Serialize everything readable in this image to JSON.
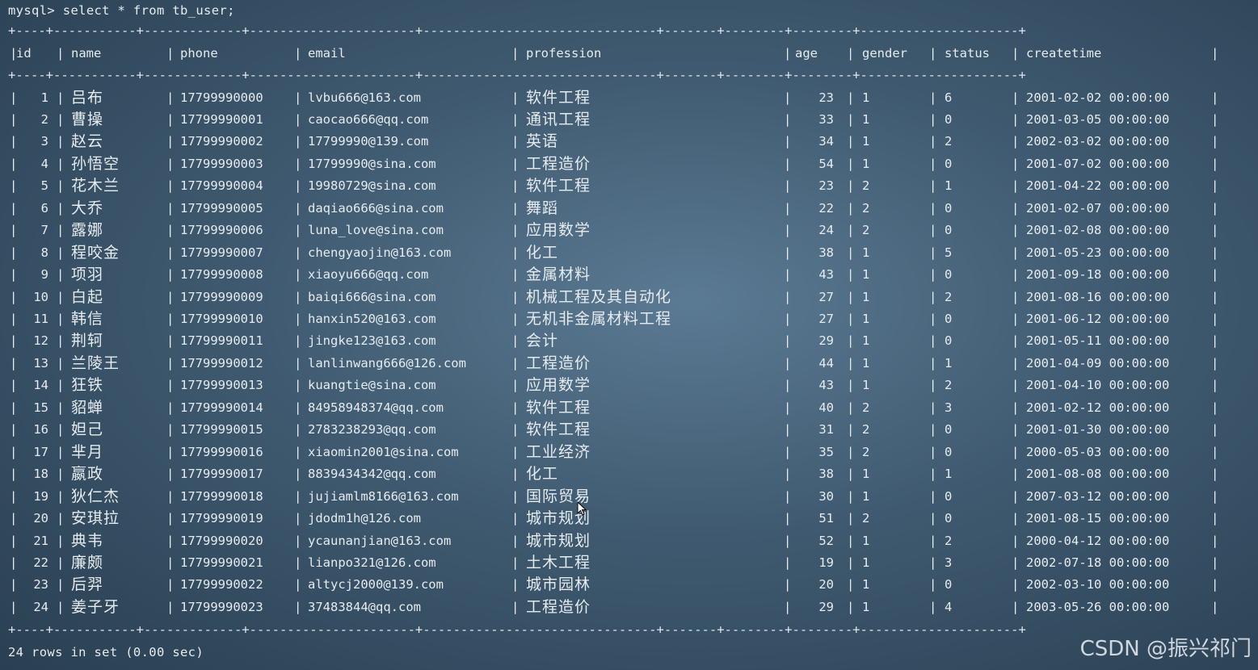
{
  "prompt": "mysql> select * from tb_user;",
  "separator": "+----+-----------+-------------+----------------------+-------------------------------+-------+--------+--------+---------------------+",
  "columns": [
    "id",
    "name",
    "phone",
    "email",
    "profession",
    "age",
    "gender",
    "status",
    "createtime"
  ],
  "rows": [
    [
      "1",
      "吕布",
      "17799990000",
      "lvbu666@163.com",
      "软件工程",
      "23",
      "1",
      "6",
      "2001-02-02 00:00:00"
    ],
    [
      "2",
      "曹操",
      "17799990001",
      "caocao666@qq.com",
      "通讯工程",
      "33",
      "1",
      "0",
      "2001-03-05 00:00:00"
    ],
    [
      "3",
      "赵云",
      "17799990002",
      "17799990@139.com",
      "英语",
      "34",
      "1",
      "2",
      "2002-03-02 00:00:00"
    ],
    [
      "4",
      "孙悟空",
      "17799990003",
      "17799990@sina.com",
      "工程造价",
      "54",
      "1",
      "0",
      "2001-07-02 00:00:00"
    ],
    [
      "5",
      "花木兰",
      "17799990004",
      "19980729@sina.com",
      "软件工程",
      "23",
      "2",
      "1",
      "2001-04-22 00:00:00"
    ],
    [
      "6",
      "大乔",
      "17799990005",
      "daqiao666@sina.com",
      "舞蹈",
      "22",
      "2",
      "0",
      "2001-02-07 00:00:00"
    ],
    [
      "7",
      "露娜",
      "17799990006",
      "luna_love@sina.com",
      "应用数学",
      "24",
      "2",
      "0",
      "2001-02-08 00:00:00"
    ],
    [
      "8",
      "程咬金",
      "17799990007",
      "chengyaojin@163.com",
      "化工",
      "38",
      "1",
      "5",
      "2001-05-23 00:00:00"
    ],
    [
      "9",
      "项羽",
      "17799990008",
      "xiaoyu666@qq.com",
      "金属材料",
      "43",
      "1",
      "0",
      "2001-09-18 00:00:00"
    ],
    [
      "10",
      "白起",
      "17799990009",
      "baiqi666@sina.com",
      "机械工程及其自动化",
      "27",
      "1",
      "2",
      "2001-08-16 00:00:00"
    ],
    [
      "11",
      "韩信",
      "17799990010",
      "hanxin520@163.com",
      "无机非金属材料工程",
      "27",
      "1",
      "0",
      "2001-06-12 00:00:00"
    ],
    [
      "12",
      "荆轲",
      "17799990011",
      "jingke123@163.com",
      "会计",
      "29",
      "1",
      "0",
      "2001-05-11 00:00:00"
    ],
    [
      "13",
      "兰陵王",
      "17799990012",
      "lanlinwang666@126.com",
      "工程造价",
      "44",
      "1",
      "1",
      "2001-04-09 00:00:00"
    ],
    [
      "14",
      "狂铁",
      "17799990013",
      "kuangtie@sina.com",
      "应用数学",
      "43",
      "1",
      "2",
      "2001-04-10 00:00:00"
    ],
    [
      "15",
      "貂蝉",
      "17799990014",
      "84958948374@qq.com",
      "软件工程",
      "40",
      "2",
      "3",
      "2001-02-12 00:00:00"
    ],
    [
      "16",
      "妲己",
      "17799990015",
      "2783238293@qq.com",
      "软件工程",
      "31",
      "2",
      "0",
      "2001-01-30 00:00:00"
    ],
    [
      "17",
      "芈月",
      "17799990016",
      "xiaomin2001@sina.com",
      "工业经济",
      "35",
      "2",
      "0",
      "2000-05-03 00:00:00"
    ],
    [
      "18",
      "嬴政",
      "17799990017",
      "8839434342@qq.com",
      "化工",
      "38",
      "1",
      "1",
      "2001-08-08 00:00:00"
    ],
    [
      "19",
      "狄仁杰",
      "17799990018",
      "jujiamlm8166@163.com",
      "国际贸易",
      "30",
      "1",
      "0",
      "2007-03-12 00:00:00"
    ],
    [
      "20",
      "安琪拉",
      "17799990019",
      "jdodm1h@126.com",
      "城市规划",
      "51",
      "2",
      "0",
      "2001-08-15 00:00:00"
    ],
    [
      "21",
      "典韦",
      "17799990020",
      "ycaunanjian@163.com",
      "城市规划",
      "52",
      "1",
      "2",
      "2000-04-12 00:00:00"
    ],
    [
      "22",
      "廉颇",
      "17799990021",
      "lianpo321@126.com",
      "土木工程",
      "19",
      "1",
      "3",
      "2002-07-18 00:00:00"
    ],
    [
      "23",
      "后羿",
      "17799990022",
      "altycj2000@139.com",
      "城市园林",
      "20",
      "1",
      "0",
      "2002-03-10 00:00:00"
    ],
    [
      "24",
      "姜子牙",
      "17799990023",
      "37483844@qq.com",
      "工程造价",
      "29",
      "1",
      "4",
      "2003-05-26 00:00:00"
    ]
  ],
  "footer": "24 rows in set (0.00 sec)",
  "watermark": "CSDN @振兴祁门"
}
